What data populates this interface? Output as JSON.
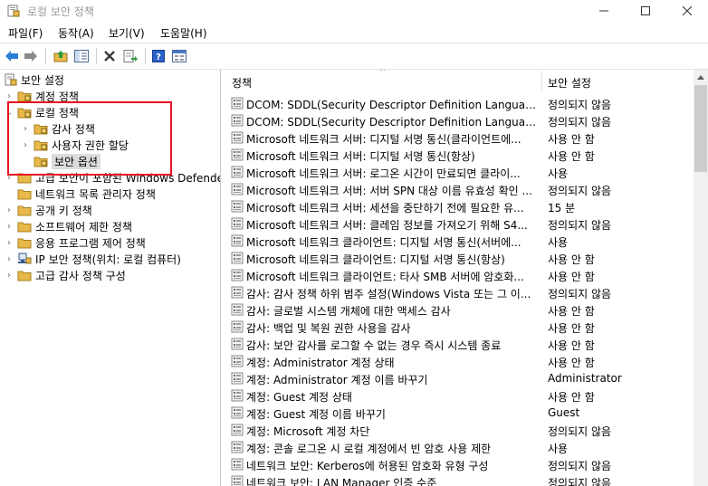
{
  "window": {
    "title": "로컬 보안 정책",
    "controls": {
      "minimize": "minimize-icon",
      "maximize": "maximize-icon",
      "close": "close-icon"
    }
  },
  "menu": [
    "파일(F)",
    "동작(A)",
    "보기(V)",
    "도움말(H)"
  ],
  "toolbar": [
    "back-arrow-icon",
    "forward-arrow-icon",
    "up-folder-icon",
    "show-hide-tree-icon",
    "delete-icon",
    "export-list-icon",
    "help-icon",
    "properties-icon"
  ],
  "tree": {
    "root": "보안 설정",
    "items": [
      {
        "label": "계정 정책",
        "expander": "›"
      },
      {
        "label": "로컬 정책",
        "expander": "⌄"
      },
      {
        "label": "감사 정책",
        "expander": "›"
      },
      {
        "label": "사용자 권한 할당",
        "expander": "›"
      },
      {
        "label": "보안 옵션",
        "expander": ""
      },
      {
        "label": "고급 보안이 포함된 Windows Defender 방화벽",
        "expander": "›"
      },
      {
        "label": "네트워크 목록 관리자 정책",
        "expander": ""
      },
      {
        "label": "공개 키 정책",
        "expander": "›"
      },
      {
        "label": "소프트웨어 제한 정책",
        "expander": "›"
      },
      {
        "label": "응용 프로그램 제어 정책",
        "expander": "›"
      },
      {
        "label": "IP 보안 정책(위치: 로컬 컴퓨터)",
        "expander": "›"
      },
      {
        "label": "고급 감사 정책 구성",
        "expander": "›"
      }
    ]
  },
  "list": {
    "columns": [
      "정책",
      "보안 설정"
    ],
    "sort_indicator": "^",
    "rows": [
      {
        "policy": "DCOM: SDDL(Security Descriptor Definition Language) 구...",
        "setting": "정의되지 않음"
      },
      {
        "policy": "DCOM: SDDL(Security Descriptor Definition Language) 구...",
        "setting": "정의되지 않음"
      },
      {
        "policy": "Microsoft 네트워크 서버: 디지털 서명 통신(클라이언트에...",
        "setting": "사용 안 함"
      },
      {
        "policy": "Microsoft 네트워크 서버: 디지털 서명 통신(항상)",
        "setting": "사용 안 함"
      },
      {
        "policy": "Microsoft 네트워크 서버: 로그온 시간이 만료되면 클라이...",
        "setting": "사용"
      },
      {
        "policy": "Microsoft 네트워크 서버: 서버 SPN 대상 이름 유효성 확인 ...",
        "setting": "정의되지 않음"
      },
      {
        "policy": "Microsoft 네트워크 서버: 세션을 중단하기 전에 필요한 유...",
        "setting": "15 분"
      },
      {
        "policy": "Microsoft 네트워크 서버: 클레임 정보를 가져오기 위해 S4...",
        "setting": "정의되지 않음"
      },
      {
        "policy": "Microsoft 네트워크 클라이언트: 디지털 서명 통신(서버에...",
        "setting": "사용"
      },
      {
        "policy": "Microsoft 네트워크 클라이언트: 디지털 서명 통신(항상)",
        "setting": "사용 안 함"
      },
      {
        "policy": "Microsoft 네트워크 클라이언트: 타사 SMB 서버에 암호화...",
        "setting": "사용 안 함"
      },
      {
        "policy": "감사: 감사 정책 하위 범주 설정(Windows Vista 또는 그 이...",
        "setting": "정의되지 않음"
      },
      {
        "policy": "감사: 글로벌 시스템 개체에 대한 액세스 감사",
        "setting": "사용 안 함"
      },
      {
        "policy": "감사: 백업 및 복원 권한 사용을 감사",
        "setting": "사용 안 함"
      },
      {
        "policy": "감사: 보안 감사를 로그할 수 없는 경우 즉시 시스템 종료",
        "setting": "사용 안 함"
      },
      {
        "policy": "계정: Administrator 계정 상태",
        "setting": "사용 안 함"
      },
      {
        "policy": "계정: Administrator 계정 이름 바꾸기",
        "setting": "Administrator"
      },
      {
        "policy": "계정: Guest 계정 상태",
        "setting": "사용 안 함"
      },
      {
        "policy": "계정: Guest 계정 이름 바꾸기",
        "setting": "Guest"
      },
      {
        "policy": "계정: Microsoft 계정 차단",
        "setting": "정의되지 않음"
      },
      {
        "policy": "계정: 콘솔 로그온 시 로컬 계정에서 빈 암호 사용 제한",
        "setting": "사용"
      },
      {
        "policy": "네트워크 보안: Kerberos에 허용된 암호화 유형 구성",
        "setting": "정의되지 않음"
      },
      {
        "policy": "네트워크 보안: LAN Manager 인증 수준",
        "setting": "정의되지 않음"
      }
    ]
  },
  "colors": {
    "highlight_box": "#e81123",
    "selected_bg": "#dcdcdc",
    "folder": "#e8b84a"
  }
}
